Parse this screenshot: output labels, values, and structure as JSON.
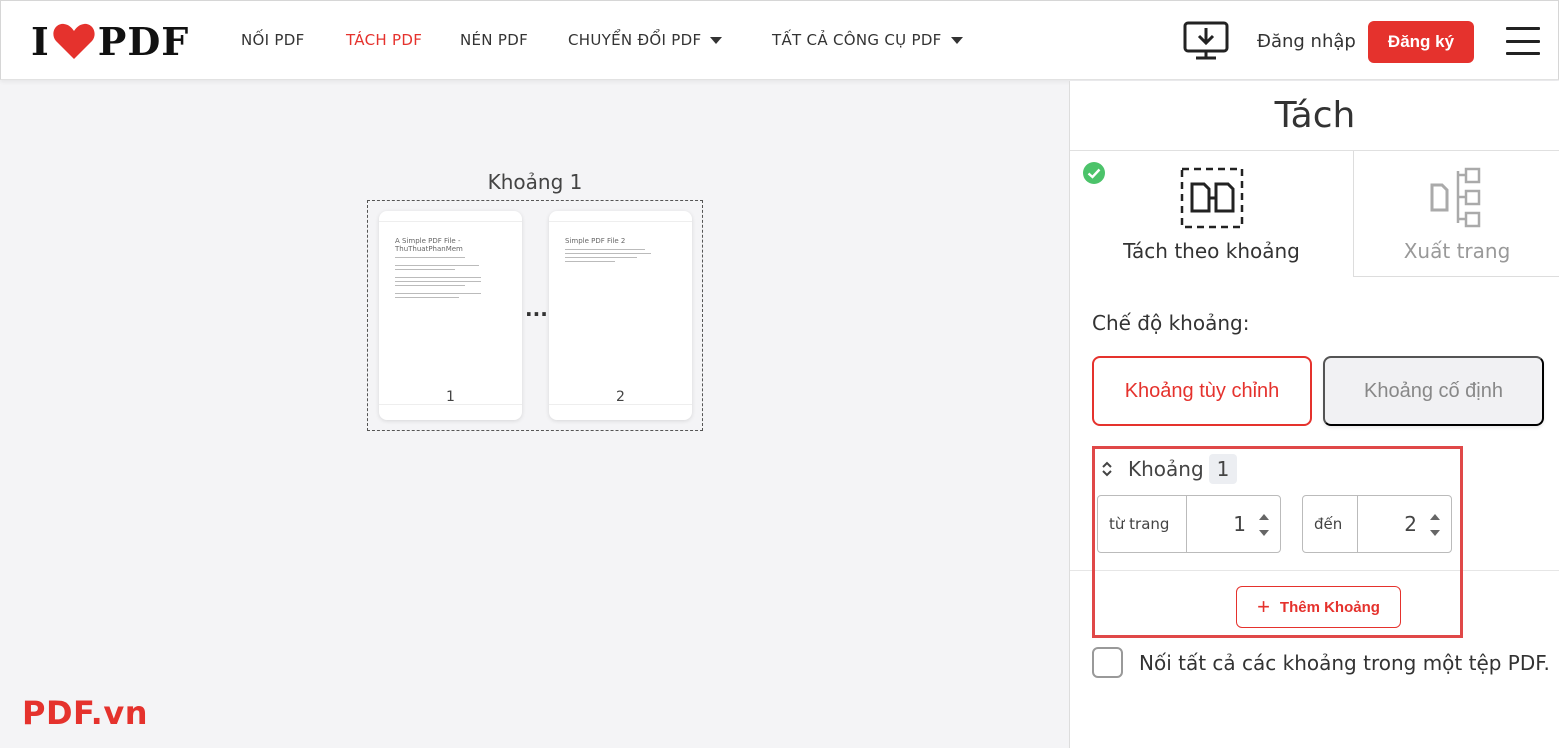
{
  "header": {
    "logo_left": "I",
    "logo_right": "PDF",
    "nav": [
      {
        "label": "NỐI PDF",
        "active": false
      },
      {
        "label": "TÁCH PDF",
        "active": true
      },
      {
        "label": "NÉN PDF",
        "active": false
      },
      {
        "label": "CHUYỂN ĐỔI PDF",
        "active": false,
        "dropdown": true
      },
      {
        "label": "TẤT CẢ CÔNG CỤ PDF",
        "active": false,
        "dropdown": true
      }
    ],
    "login": "Đăng nhập",
    "signup": "Đăng ký",
    "icons": {
      "desktop": "desktop-download-icon",
      "menu": "hamburger-menu-icon"
    }
  },
  "preview": {
    "range_title": "Khoảng 1",
    "pages": [
      {
        "number": "1",
        "doc_title": "A Simple PDF File - ThuThuatPhanMem"
      },
      {
        "number": "2",
        "doc_title": "Simple PDF File 2"
      }
    ],
    "ellipsis": "..."
  },
  "panel": {
    "title": "Tách",
    "tabs": [
      {
        "label": "Tách theo khoảng",
        "selected": true,
        "icon": "split-range-icon"
      },
      {
        "label": "Xuất trang",
        "selected": false,
        "icon": "extract-pages-icon"
      }
    ],
    "mode_label": "Chế độ khoảng:",
    "modes": [
      {
        "label": "Khoảng tùy chỉnh",
        "selected": true
      },
      {
        "label": "Khoảng cố định",
        "selected": false
      }
    ],
    "range": {
      "label": "Khoảng",
      "index": "1",
      "from_label": "từ trang",
      "from_value": "1",
      "to_label": "đến",
      "to_value": "2"
    },
    "add_range": "Thêm Khoảng",
    "merge_label": "Nối tất cả các khoảng trong một tệp PDF.",
    "merge_checked": false
  },
  "watermark": "PDF.vn",
  "colors": {
    "accent": "#e5322d",
    "check": "#4cc36a"
  }
}
